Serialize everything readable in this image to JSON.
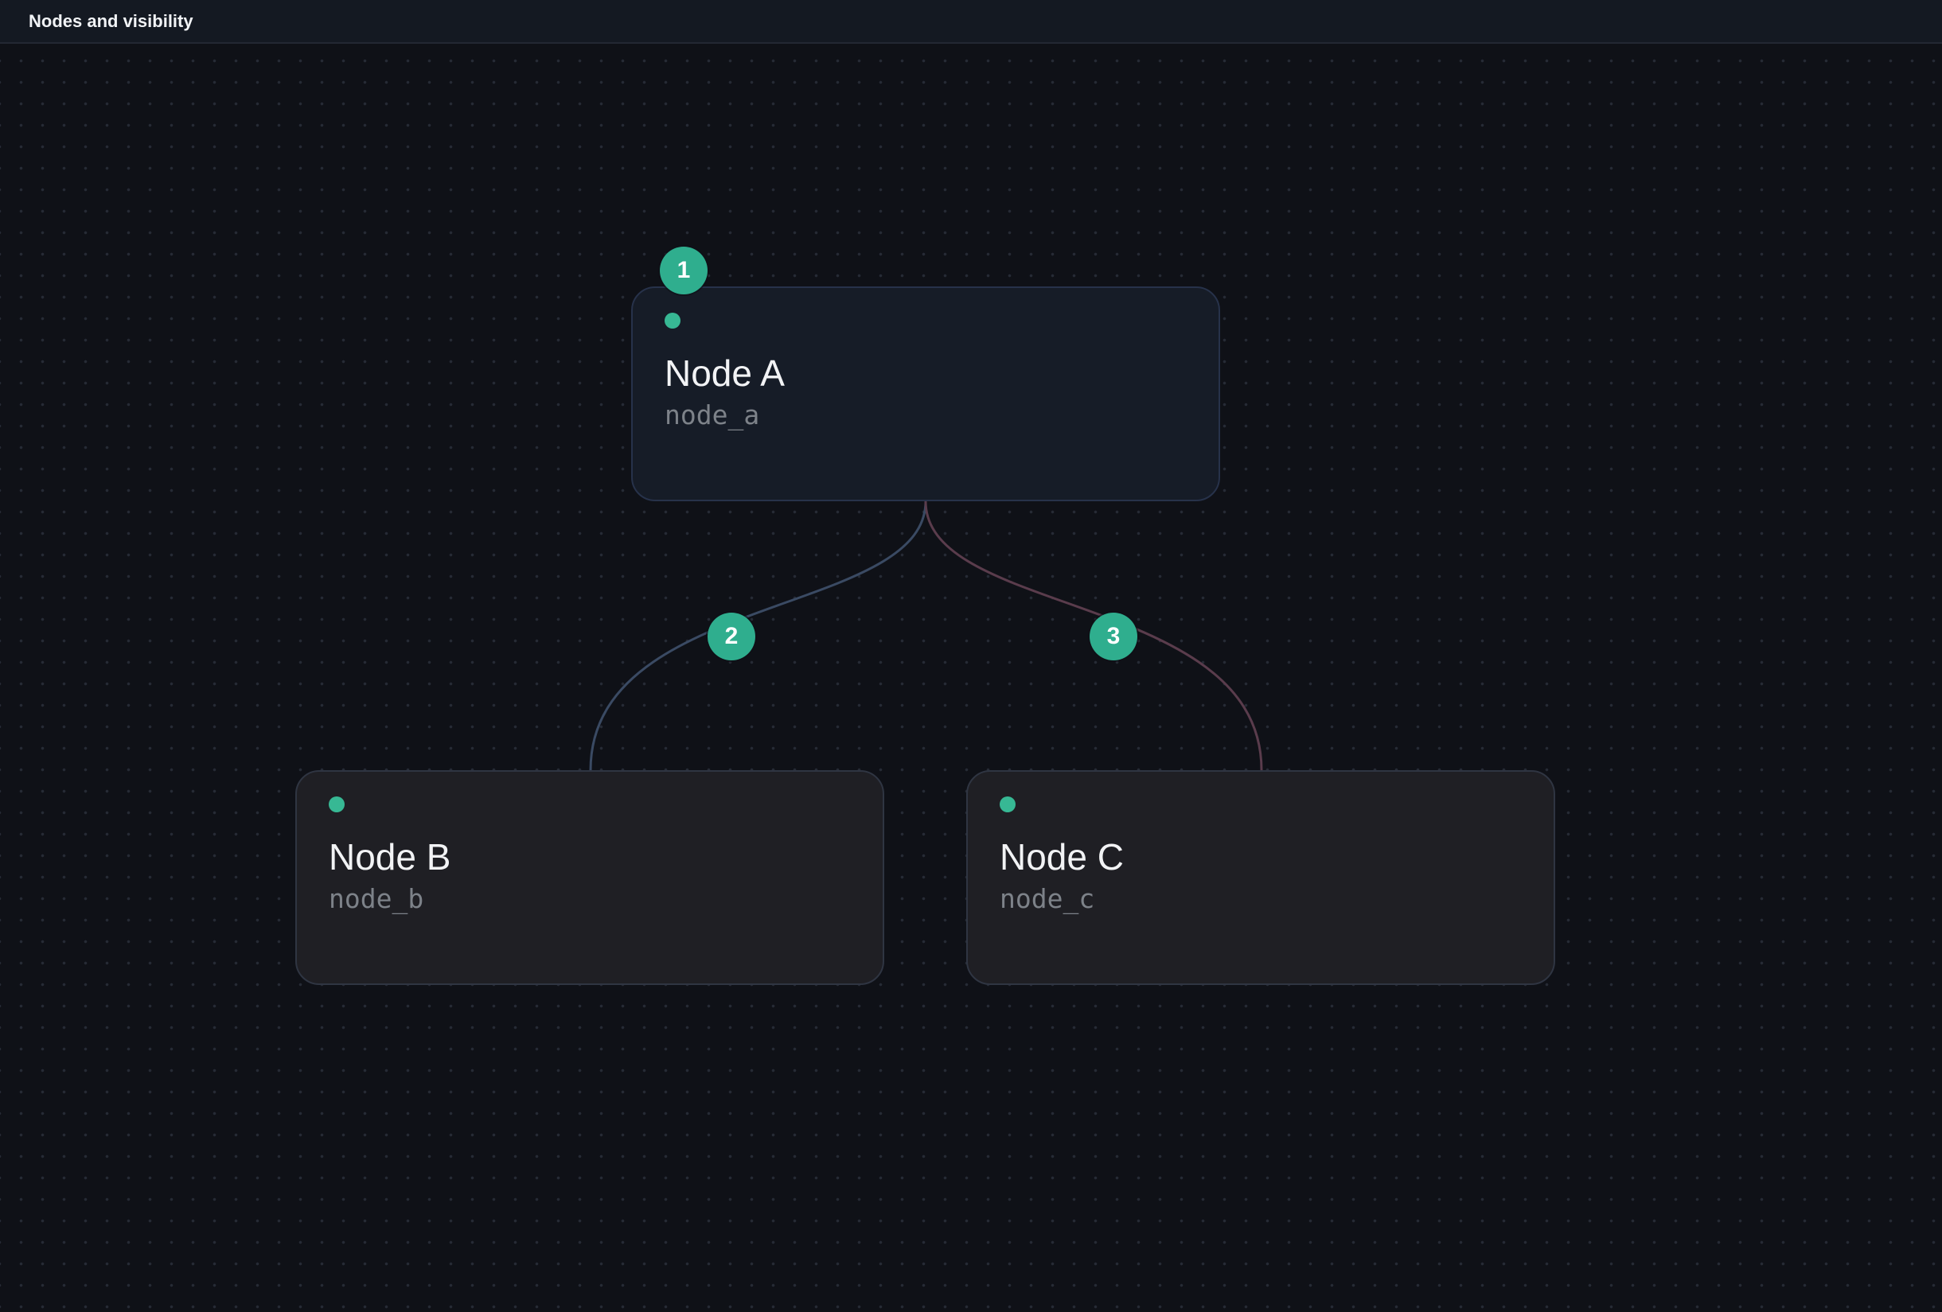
{
  "header": {
    "title": "Nodes and visibility"
  },
  "colors": {
    "background": "#0f1117",
    "accent": "#37b894",
    "badge": "#2fae8e",
    "edge_b": "#3a4a63",
    "edge_c": "#5a3c4c"
  },
  "nodes": [
    {
      "label": "Node A",
      "id": "node_a",
      "status_icon": "status-dot-icon"
    },
    {
      "label": "Node B",
      "id": "node_b",
      "status_icon": "status-dot-icon"
    },
    {
      "label": "Node C",
      "id": "node_c",
      "status_icon": "status-dot-icon"
    }
  ],
  "badges": [
    "1",
    "2",
    "3"
  ],
  "edges": [
    {
      "from": "node_a",
      "to": "node_b"
    },
    {
      "from": "node_a",
      "to": "node_c"
    }
  ]
}
